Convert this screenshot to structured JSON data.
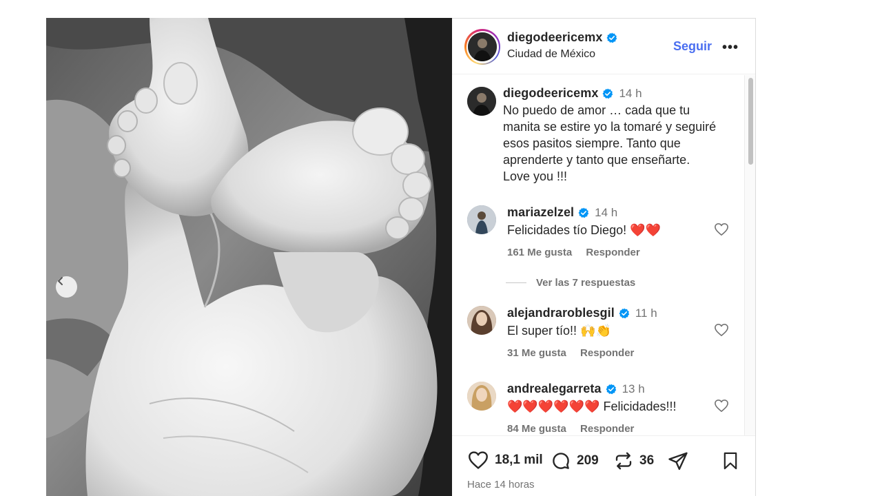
{
  "post": {
    "author": "diegodeericemx",
    "location": "Ciudad de México",
    "follow_label": "Seguir",
    "more_label": "•••"
  },
  "caption": {
    "username": "diegodeericemx",
    "time": "14 h",
    "lines": [
      "No puedo de amor … cada que tu",
      "manita se estire yo la tomaré y seguiré",
      "esos pasitos siempre. Tanto que",
      "aprenderte y tanto que enseñarte.",
      "Love you !!!"
    ]
  },
  "comments": [
    {
      "username": "mariazelzel",
      "time": "14 h",
      "text": "Felicidades tío Diego! ❤️❤️",
      "likes": "161 Me gusta",
      "reply": "Responder",
      "view_replies": "Ver las 7 respuestas"
    },
    {
      "username": "alejandraroblesgil",
      "time": "11 h",
      "text": "El super tío!! 🙌👏",
      "likes": "31 Me gusta",
      "reply": "Responder"
    },
    {
      "username": "andrealegarreta",
      "time": "13 h",
      "text": "❤️❤️❤️❤️❤️❤️ Felicidades!!!",
      "likes": "84 Me gusta",
      "reply": "Responder"
    }
  ],
  "actions": {
    "likes": "18,1 mil",
    "comments": "209",
    "reposts": "36",
    "posted": "Hace 14 horas"
  },
  "colors": {
    "verified": "#0095f6",
    "follow": "#4a6ef0",
    "muted": "#737373",
    "text": "#262626"
  },
  "icons": [
    "verified-badge-icon",
    "heart-icon",
    "comment-icon",
    "repost-icon",
    "share-icon",
    "bookmark-icon",
    "chevron-left-icon",
    "more-icon"
  ]
}
